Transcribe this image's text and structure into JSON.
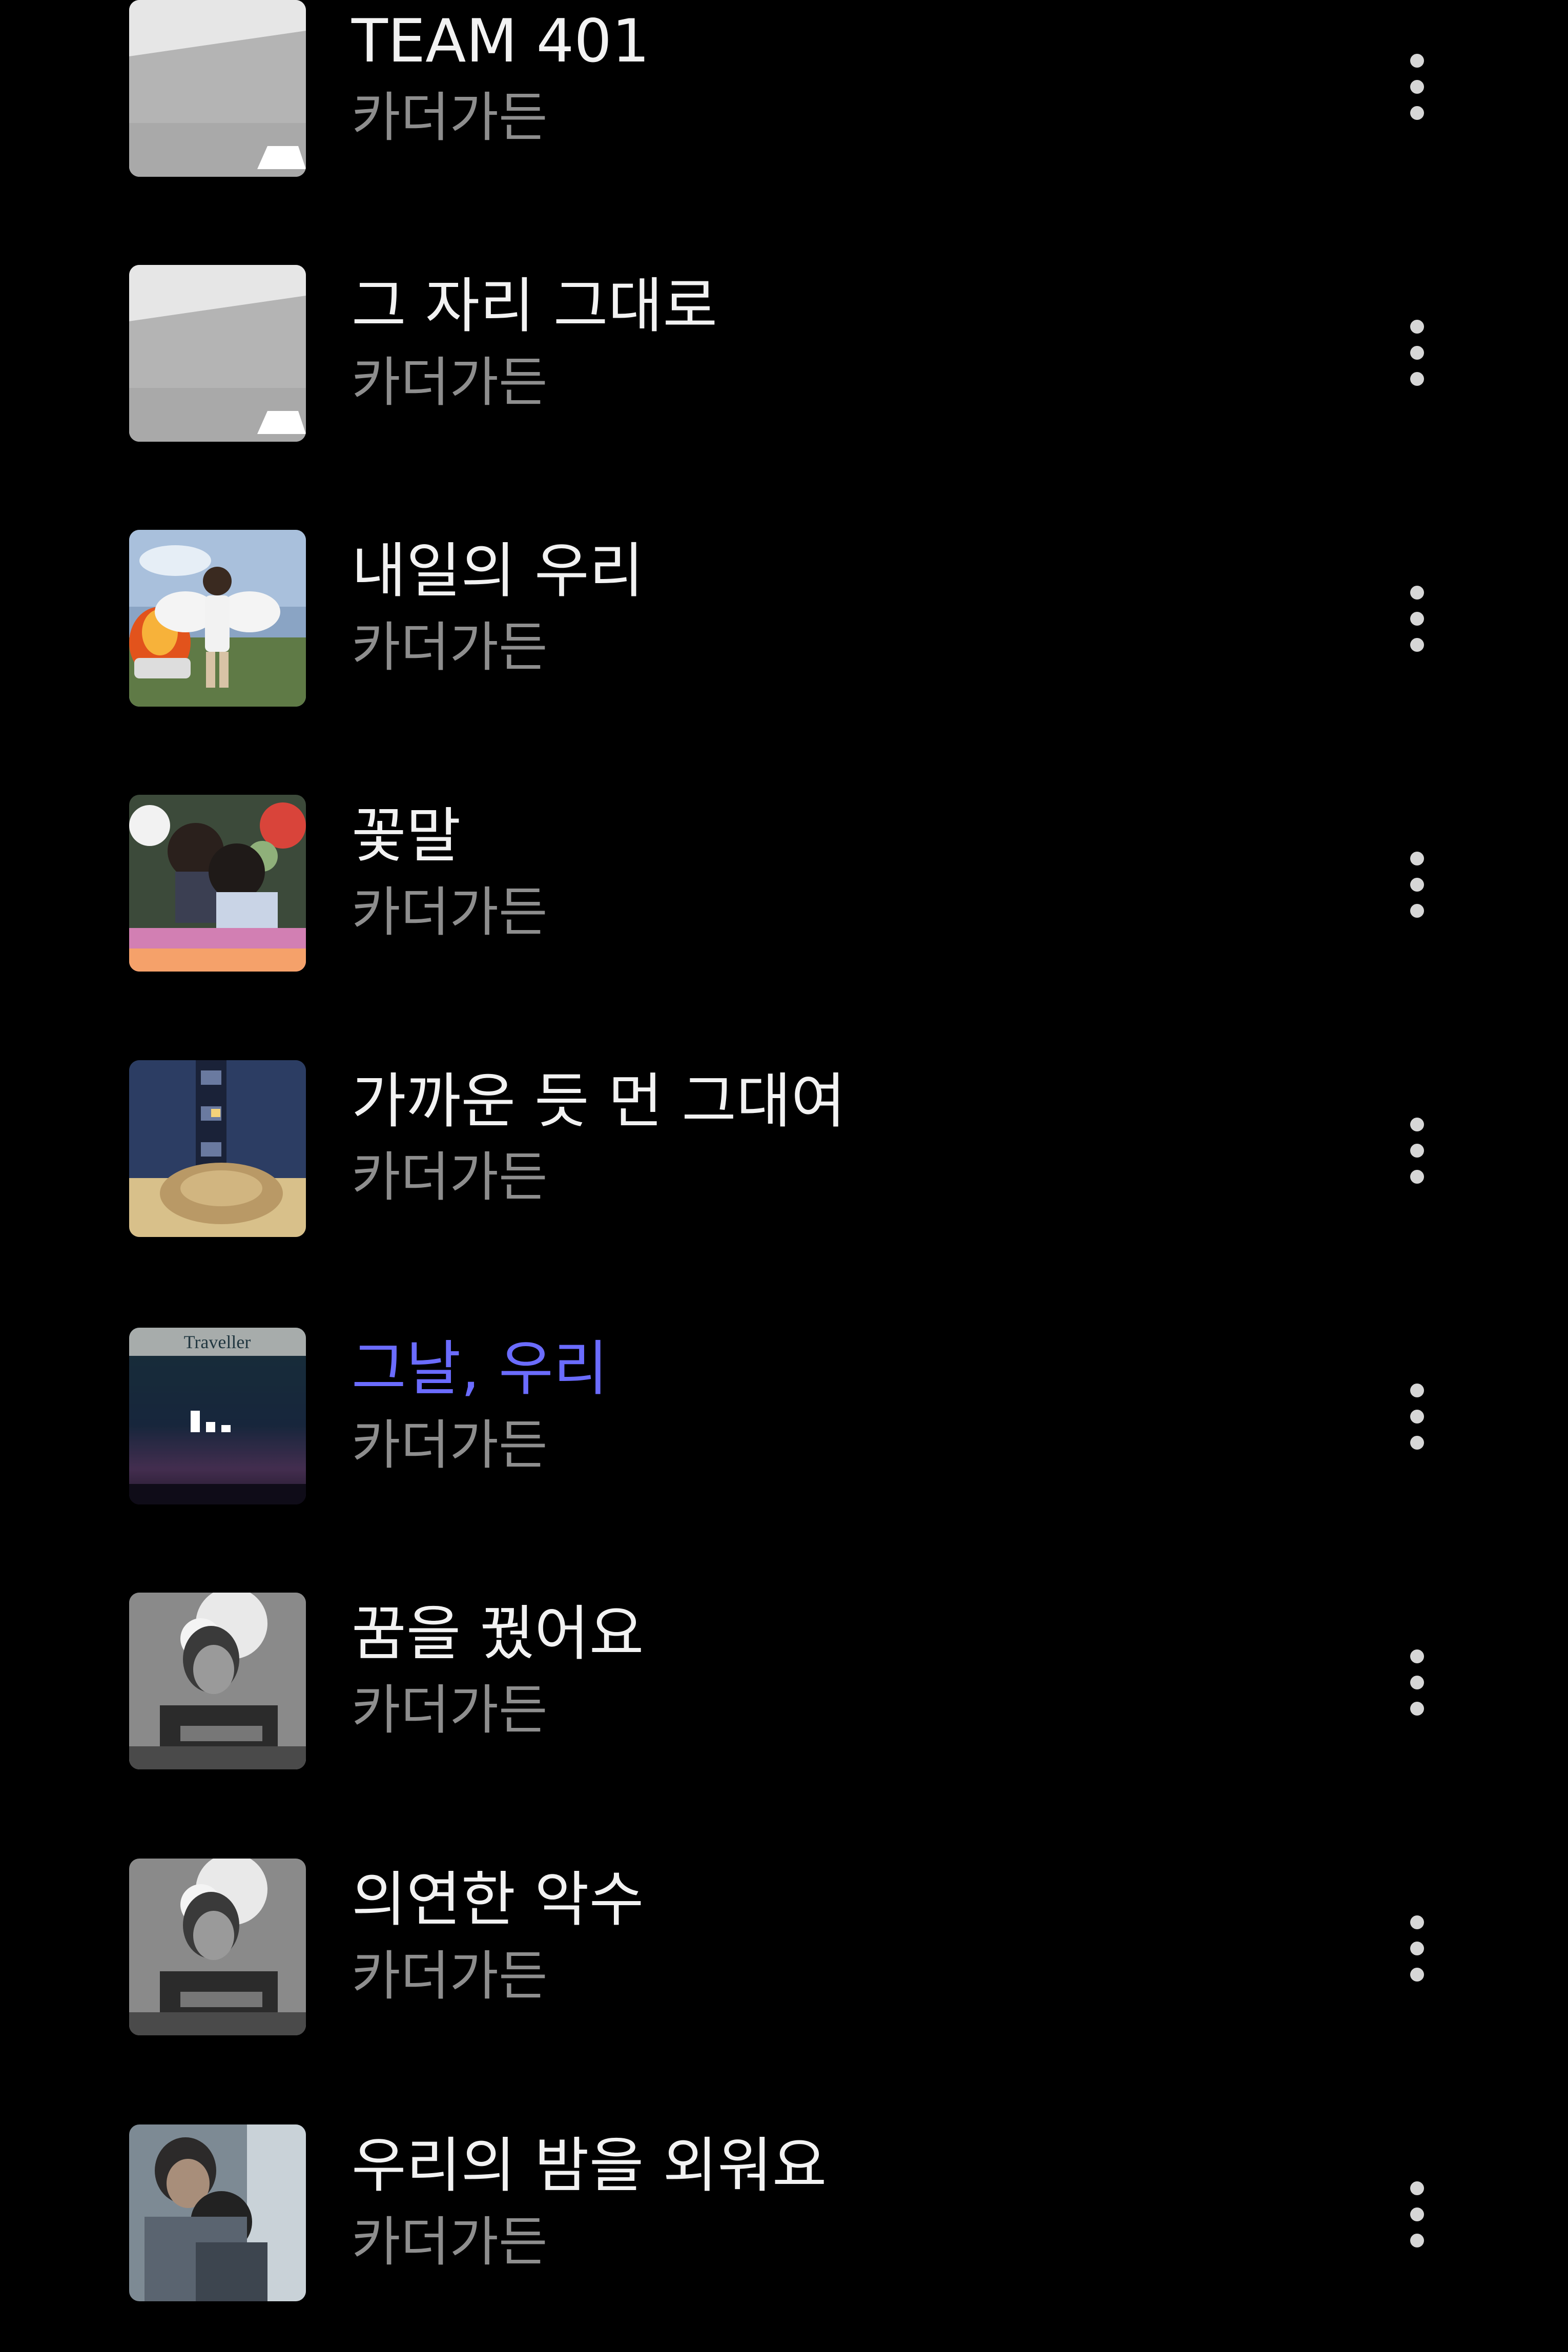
{
  "songs": [
    {
      "title": "TEAM 401",
      "artist": "카더가든",
      "active": false,
      "cover": "empty-room"
    },
    {
      "title": "그 자리 그대로",
      "artist": "카더가든",
      "active": false,
      "cover": "empty-room"
    },
    {
      "title": "내일의 우리",
      "artist": "카더가든",
      "active": false,
      "cover": "angel-fire"
    },
    {
      "title": "꽃말",
      "artist": "카더가든",
      "active": false,
      "cover": "flower-couple"
    },
    {
      "title": "가까운 듯 먼 그대여",
      "artist": "카더가든",
      "active": false,
      "cover": "night-building"
    },
    {
      "title": "그날, 우리",
      "artist": "카더가든",
      "active": true,
      "cover": "traveller-dusk",
      "cover_text": "Traveller"
    },
    {
      "title": "꿈을 꿨어요",
      "artist": "카더가든",
      "active": false,
      "cover": "bw-portrait"
    },
    {
      "title": "의연한 악수",
      "artist": "카더가든",
      "active": false,
      "cover": "bw-portrait"
    },
    {
      "title": "우리의 밤을 외워요",
      "artist": "카더가든",
      "active": false,
      "cover": "embrace-photo"
    }
  ],
  "colors": {
    "background": "#000000",
    "title": "#f2f2f2",
    "active_title": "#6b6cff",
    "artist": "#8e8e8e",
    "more_dots": "#d6d6d6"
  },
  "icons": {
    "more": "more-vertical-icon",
    "playing": "equalizer-icon"
  }
}
